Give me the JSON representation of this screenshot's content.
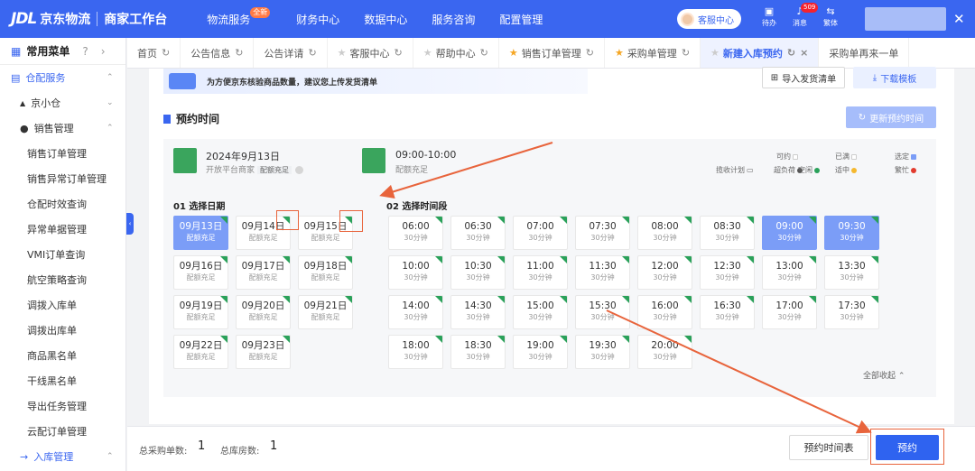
{
  "topbar": {
    "logo": "JDL",
    "brand": "京东物流",
    "subtitle": "商家工作台",
    "nav": [
      "物流服务",
      "财务中心",
      "数据中心",
      "服务咨询",
      "配置管理"
    ],
    "nav_badge": "全新",
    "service": "客服中心",
    "icons": [
      {
        "label": "待办"
      },
      {
        "label": "消息",
        "badge": "509"
      },
      {
        "label": "繁体"
      }
    ]
  },
  "sidebar": {
    "title": "常用菜单",
    "section": "仓配服务",
    "group1": "京小仓",
    "group2": "销售管理",
    "items": [
      "销售订单管理",
      "销售异常订单管理",
      "仓配时效查询",
      "异常单据管理",
      "VMI订单查询",
      "航空策略查询",
      "调拨入库单",
      "调拨出库单",
      "商品黑名单",
      "干线黑名单",
      "导出任务管理",
      "云配订单管理"
    ],
    "bottom": "入库管理"
  },
  "tabs": [
    {
      "label": "首页"
    },
    {
      "label": "公告信息"
    },
    {
      "label": "公告详请"
    },
    {
      "label": "客服中心"
    },
    {
      "label": "帮助中心"
    },
    {
      "label": "销售订单管理"
    },
    {
      "label": "采购单管理"
    },
    {
      "label": "新建入库预约",
      "active": true
    },
    {
      "label": "采购单再来一单"
    }
  ],
  "banner": "为方便京东核验商品数量，建议您上传发货清单",
  "import_btn": "导入发货清单",
  "download_btn": "下载模板",
  "section_title": "预约时间",
  "refresh_btn": "更新预约时间",
  "summary": {
    "date": "2024年9月13日",
    "platform": "开放平台商家",
    "quota_tag": "配额充足",
    "time": "09:00-10:00",
    "quota": "配额充足"
  },
  "legend": {
    "plan": "揽收计划",
    "overload": "超负荷",
    "idle": "空闲",
    "available": "可约",
    "medium": "适中",
    "booked": "已满",
    "busy": "繁忙",
    "selected": "选定"
  },
  "dates_title": "01 选择日期",
  "times_title": "02 选择时间段",
  "dates": [
    {
      "d": "09月13日",
      "s": "配额充足",
      "sel": true
    },
    {
      "d": "09月14日",
      "s": "配额充足"
    },
    {
      "d": "09月15日",
      "s": "配额充足"
    },
    {
      "d": "09月16日",
      "s": "配额充足"
    },
    {
      "d": "09月17日",
      "s": "配额充足"
    },
    {
      "d": "09月18日",
      "s": "配额充足"
    },
    {
      "d": "09月19日",
      "s": "配额充足"
    },
    {
      "d": "09月20日",
      "s": "配额充足"
    },
    {
      "d": "09月21日",
      "s": "配额充足"
    },
    {
      "d": "09月22日",
      "s": "配额充足"
    },
    {
      "d": "09月23日",
      "s": "配额充足"
    }
  ],
  "times": [
    {
      "t": "06:00",
      "s": "30分钟"
    },
    {
      "t": "06:30",
      "s": "30分钟"
    },
    {
      "t": "07:00",
      "s": "30分钟"
    },
    {
      "t": "07:30",
      "s": "30分钟"
    },
    {
      "t": "08:00",
      "s": "30分钟"
    },
    {
      "t": "08:30",
      "s": "30分钟"
    },
    {
      "t": "09:00",
      "s": "30分钟",
      "sel": true
    },
    {
      "t": "09:30",
      "s": "30分钟",
      "sel": true
    },
    {
      "t": "10:00",
      "s": "30分钟"
    },
    {
      "t": "10:30",
      "s": "30分钟"
    },
    {
      "t": "11:00",
      "s": "30分钟"
    },
    {
      "t": "11:30",
      "s": "30分钟"
    },
    {
      "t": "12:00",
      "s": "30分钟"
    },
    {
      "t": "12:30",
      "s": "30分钟"
    },
    {
      "t": "13:00",
      "s": "30分钟"
    },
    {
      "t": "13:30",
      "s": "30分钟"
    },
    {
      "t": "14:00",
      "s": "30分钟"
    },
    {
      "t": "14:30",
      "s": "30分钟"
    },
    {
      "t": "15:00",
      "s": "30分钟"
    },
    {
      "t": "15:30",
      "s": "30分钟"
    },
    {
      "t": "16:00",
      "s": "30分钟"
    },
    {
      "t": "16:30",
      "s": "30分钟"
    },
    {
      "t": "17:00",
      "s": "30分钟"
    },
    {
      "t": "17:30",
      "s": "30分钟"
    },
    {
      "t": "18:00",
      "s": "30分钟"
    },
    {
      "t": "18:30",
      "s": "30分钟"
    },
    {
      "t": "19:00",
      "s": "30分钟"
    },
    {
      "t": "19:30",
      "s": "30分钟"
    },
    {
      "t": "20:00",
      "s": "30分钟"
    }
  ],
  "fold": "全部收起",
  "bottom": {
    "po_label": "总采购单数:",
    "po_val": "1",
    "wh_label": "总库房数:",
    "wh_val": "1",
    "table_btn": "预约时间表",
    "book_btn": "预约"
  },
  "colors": {
    "primary": "#3a66f0",
    "selected": "#7b9df7",
    "green": "#2aa15a",
    "annot": "#e8643c"
  }
}
